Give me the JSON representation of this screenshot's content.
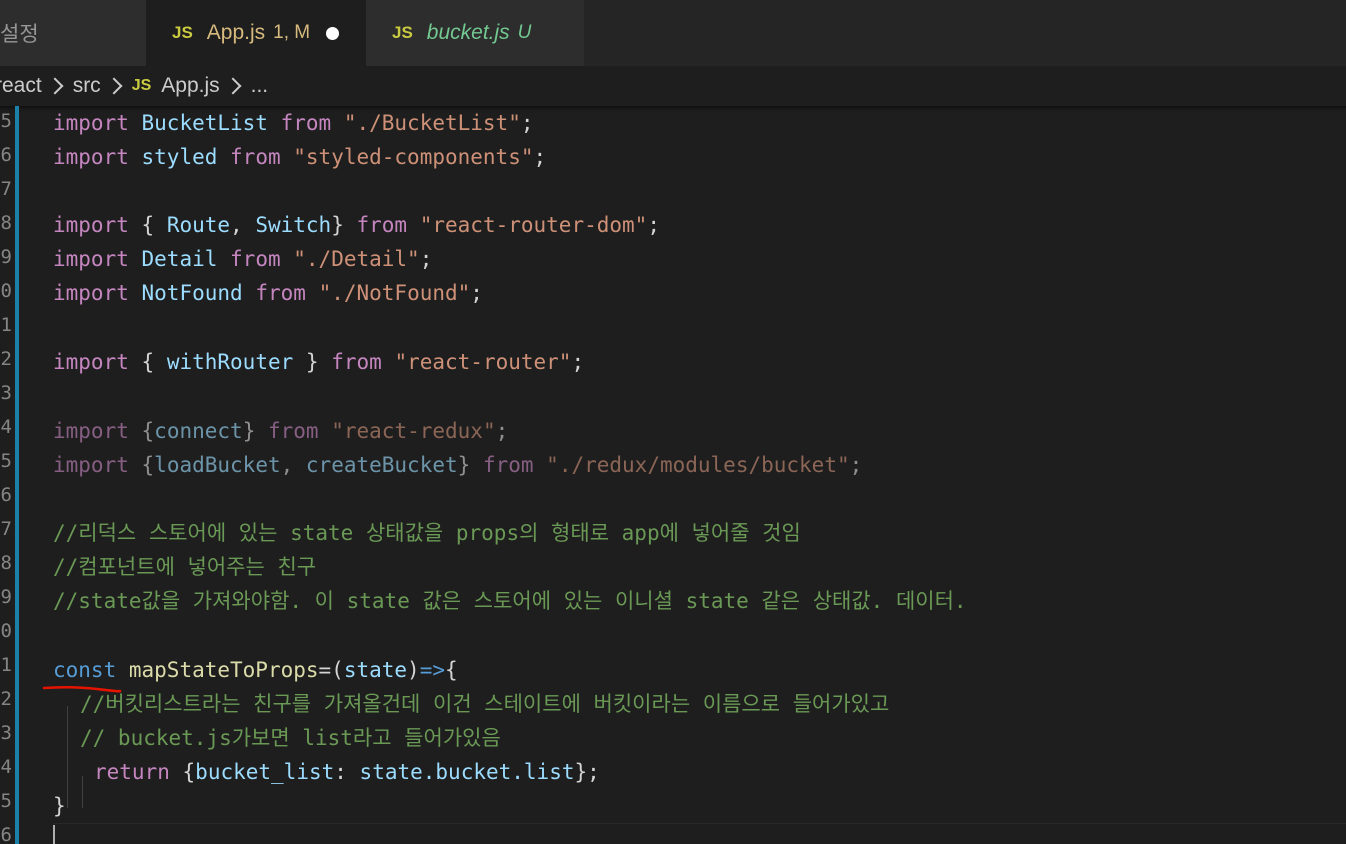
{
  "tabs": [
    {
      "label": "설정",
      "badge": "",
      "status": ""
    },
    {
      "label": "App.js",
      "badge": "JS",
      "status": "1, M"
    },
    {
      "label": "bucket.js",
      "badge": "JS",
      "status": "U"
    }
  ],
  "breadcrumb": {
    "root": "-react",
    "folder": "src",
    "badge": "JS",
    "file": "App.js",
    "more": "..."
  },
  "line_numbers": [
    "5",
    "6",
    "7",
    "8",
    "9",
    "0",
    "1",
    "2",
    "3",
    "4",
    "5",
    "6",
    "7",
    "8",
    "9",
    "0",
    "1",
    "2",
    "3",
    "4",
    "5",
    "6"
  ],
  "code": {
    "l1": {
      "kw1": "import",
      "id": "BucketList",
      "kw2": "from",
      "str": "\"./BucketList\"",
      "end": ";"
    },
    "l2": {
      "kw1": "import",
      "id": "styled",
      "kw2": "from",
      "str": "\"styled-components\"",
      "end": ";"
    },
    "l4": {
      "kw1": "import",
      "open": "{ ",
      "id1": "Route",
      "comma": ", ",
      "id2": "Switch",
      "close": "}",
      "kw2": "from",
      "str": "\"react-router-dom\"",
      "end": ";"
    },
    "l5": {
      "kw1": "import",
      "id": "Detail",
      "kw2": "from",
      "str": "\"./Detail\"",
      "end": ";"
    },
    "l6": {
      "kw1": "import",
      "id": "NotFound",
      "kw2": "from",
      "str": "\"./NotFound\"",
      "end": ";"
    },
    "l8": {
      "kw1": "import",
      "open": "{ ",
      "id": "withRouter",
      "close": " }",
      "kw2": "from",
      "str": "\"react-router\"",
      "end": ";"
    },
    "l10": {
      "kw1": "import",
      "open": "{",
      "id": "connect",
      "close": "}",
      "kw2": "from",
      "str": "\"react-redux\"",
      "end": ";"
    },
    "l11": {
      "kw1": "import",
      "open": "{",
      "id1": "loadBucket",
      "comma": ", ",
      "id2": "createBucket",
      "close": "}",
      "kw2": "from",
      "str": "\"./redux/modules/bucket\"",
      "end": ";"
    },
    "c13": "//리덕스 스토어에 있는 state 상태값을 props의 형태로 app에 넣어줄 것임",
    "c14": "//컴포넌트에 넣어주는 친구",
    "c15": "//state값을 가져와야함. 이 state 값은 스토어에 있는 이니셜 state 같은 상태값. 데이터.",
    "l17": {
      "dec": "const",
      "fn": "mapStateToProps",
      "eq": "=(",
      "param": "state",
      "close": ")",
      "arrow": "=>",
      "brace": "{"
    },
    "c18": "//버킷리스트라는 친구를 가져올건데 이건 스테이트에 버킷이라는 이름으로 들어가있고",
    "c19": "// bucket.js가보면 list라고 들어가있음",
    "l20": {
      "kw": "return",
      "open": "{",
      "key": "bucket_list",
      "colon": ": ",
      "expr": "state.bucket.list",
      "close": "}",
      "end": ";"
    },
    "l21": {
      "brace": "}"
    }
  },
  "colors": {
    "keyword": "#c586c0",
    "identifier": "#9cdcfe",
    "string": "#ce9178",
    "comment": "#6a9955",
    "declaration": "#569cd6",
    "function": "#dcdcaa",
    "annotation_underline": "#e51400",
    "change_bar": "#1b81a8"
  }
}
